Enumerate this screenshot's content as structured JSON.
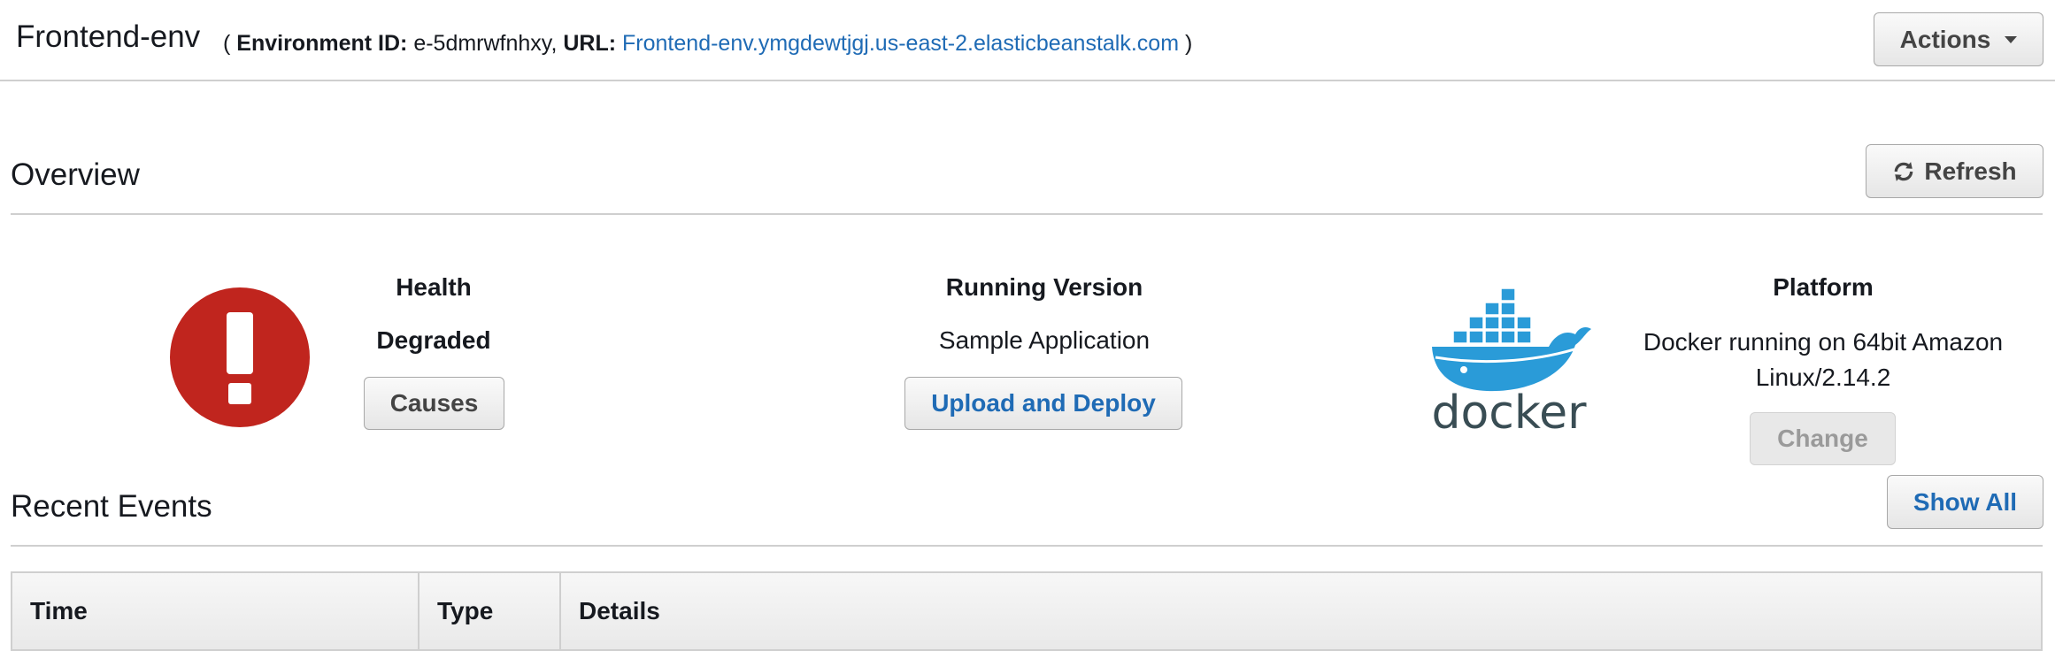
{
  "header": {
    "env_name": "Frontend-env",
    "open_paren": "(",
    "env_id_label": "Environment ID:",
    "env_id": "e-5dmrwfnhxy,",
    "url_label": "URL:",
    "url": "Frontend-env.ymgdewtjgj.us-east-2.elasticbeanstalk.com",
    "close_paren": ")",
    "actions_label": "Actions"
  },
  "overview": {
    "title": "Overview",
    "refresh_label": "Refresh",
    "health": {
      "label": "Health",
      "value": "Degraded",
      "button": "Causes",
      "icon": "exclamation-circle-icon",
      "color": "#c0251e"
    },
    "running_version": {
      "label": "Running Version",
      "value": "Sample Application",
      "button": "Upload and Deploy"
    },
    "platform": {
      "logo": "docker-logo",
      "logo_text": "docker",
      "label": "Platform",
      "value": "Docker running on 64bit Amazon Linux/2.14.2",
      "button": "Change"
    }
  },
  "recent_events": {
    "title": "Recent Events",
    "show_all_label": "Show All",
    "columns": [
      "Time",
      "Type",
      "Details"
    ]
  },
  "colors": {
    "link": "#1f6bb5",
    "docker_blue": "#2a9bd8",
    "docker_text": "#394d54"
  }
}
